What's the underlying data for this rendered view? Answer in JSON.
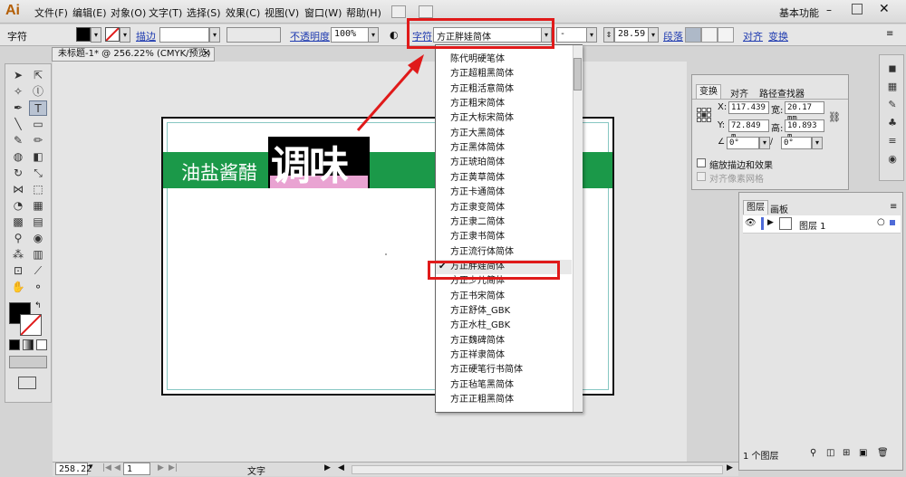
{
  "menubar": {
    "logo": "Ai",
    "items": [
      "文件(F)",
      "编辑(E)",
      "对象(O)",
      "文字(T)",
      "选择(S)",
      "效果(C)",
      "视图(V)",
      "窗口(W)",
      "帮助(H)"
    ],
    "workspace": "基本功能"
  },
  "controlbar": {
    "panel_label": "字符",
    "stroke_link": "描边",
    "opacity_link": "不透明度",
    "opacity_value": "100%",
    "char_link": "字符",
    "font_name": "方正胖娃简体",
    "font_style": "-",
    "font_size": "28.59",
    "paragraph_link": "段落",
    "align_link": "对齐",
    "transform_link": "变换"
  },
  "document": {
    "tab_title": "未标题-1* @ 256.22% (CMYK/预览)",
    "label_text": "油盐酱醋",
    "title_text": "调味"
  },
  "font_list": {
    "items": [
      "陈代明硬笔体",
      "方正超粗黑简体",
      "方正粗活意简体",
      "方正粗宋简体",
      "方正大标宋简体",
      "方正大黑简体",
      "方正黑体简体",
      "方正琥珀简体",
      "方正黄草简体",
      "方正卡通简体",
      "方正隶变简体",
      "方正隶二简体",
      "方正隶书简体",
      "方正流行体简体",
      "方正胖娃简体",
      "方正少儿简体",
      "方正书宋简体",
      "方正舒体_GBK",
      "方正水柱_GBK",
      "方正魏碑简体",
      "方正祥隶简体",
      "方正硬笔行书简体",
      "方正毡笔黑简体",
      "方正正粗黑简体"
    ],
    "selected_index": 14
  },
  "transform_panel": {
    "tabs": [
      "变换",
      "对齐",
      "路径查找器"
    ],
    "x_label": "X:",
    "x_value": "117.439",
    "w_label": "宽:",
    "w_value": "20.17 mm",
    "y_label": "Y:",
    "y_value": "72.849 m",
    "h_label": "高:",
    "h_value": "10.893 m",
    "rotate_value": "0°",
    "shear_value": "0°",
    "scale_stroke_label": "缩放描边和效果",
    "align_pixel_label": "对齐像素网格"
  },
  "layers_panel": {
    "tabs": [
      "图层",
      "画板"
    ],
    "layer_name": "图层 1",
    "count": "1 个图层"
  },
  "statusbar": {
    "zoom": "258.22",
    "page": "1",
    "tool": "文字"
  }
}
